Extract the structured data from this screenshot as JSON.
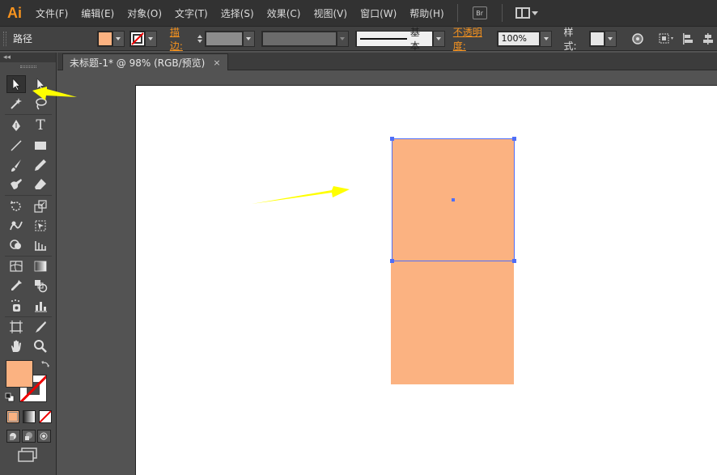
{
  "app": {
    "logo": "Ai",
    "menu": [
      "文件(F)",
      "编辑(E)",
      "对象(O)",
      "文字(T)",
      "选择(S)",
      "效果(C)",
      "视图(V)",
      "窗口(W)",
      "帮助(H)"
    ],
    "bridge_label": "Br"
  },
  "control_bar": {
    "object_type": "路径",
    "fill_color": "#fbb281",
    "stroke_label": "描边:",
    "stroke_profile_label": "基本",
    "opacity_label": "不透明度:",
    "opacity_value": "100%",
    "style_label": "样式:"
  },
  "document": {
    "tab_title": "未标题-1* @ 98% (RGB/预览)",
    "close_glyph": "×"
  },
  "toolbox": {
    "collapse_glyph": "◂◂",
    "tools": [
      [
        "selection-tool",
        "direct-selection-tool"
      ],
      [
        "magic-wand-tool",
        "lasso-tool"
      ],
      [
        "pen-tool",
        "type-tool"
      ],
      [
        "line-segment-tool",
        "rectangle-tool"
      ],
      [
        "paintbrush-tool",
        "pencil-tool"
      ],
      [
        "blob-brush-tool",
        "eraser-tool"
      ],
      [
        "rotate-tool",
        "scale-tool"
      ],
      [
        "warp-tool",
        "free-transform-tool"
      ],
      [
        "shape-builder-tool",
        "perspective-grid-tool"
      ],
      [
        "mesh-tool",
        "gradient-tool"
      ],
      [
        "eyedropper-tool",
        "blend-tool"
      ],
      [
        "symbol-sprayer-tool",
        "column-graph-tool"
      ],
      [
        "artboard-tool",
        "slice-tool"
      ],
      [
        "hand-tool",
        "zoom-tool"
      ]
    ],
    "type_tool_glyph": "T",
    "fill_color": "#fbb281"
  },
  "colors": {
    "shape_fill": "#fbb281",
    "selection": "#4f6ef7",
    "arrow": "#ffff00",
    "accent": "#f7931e"
  }
}
